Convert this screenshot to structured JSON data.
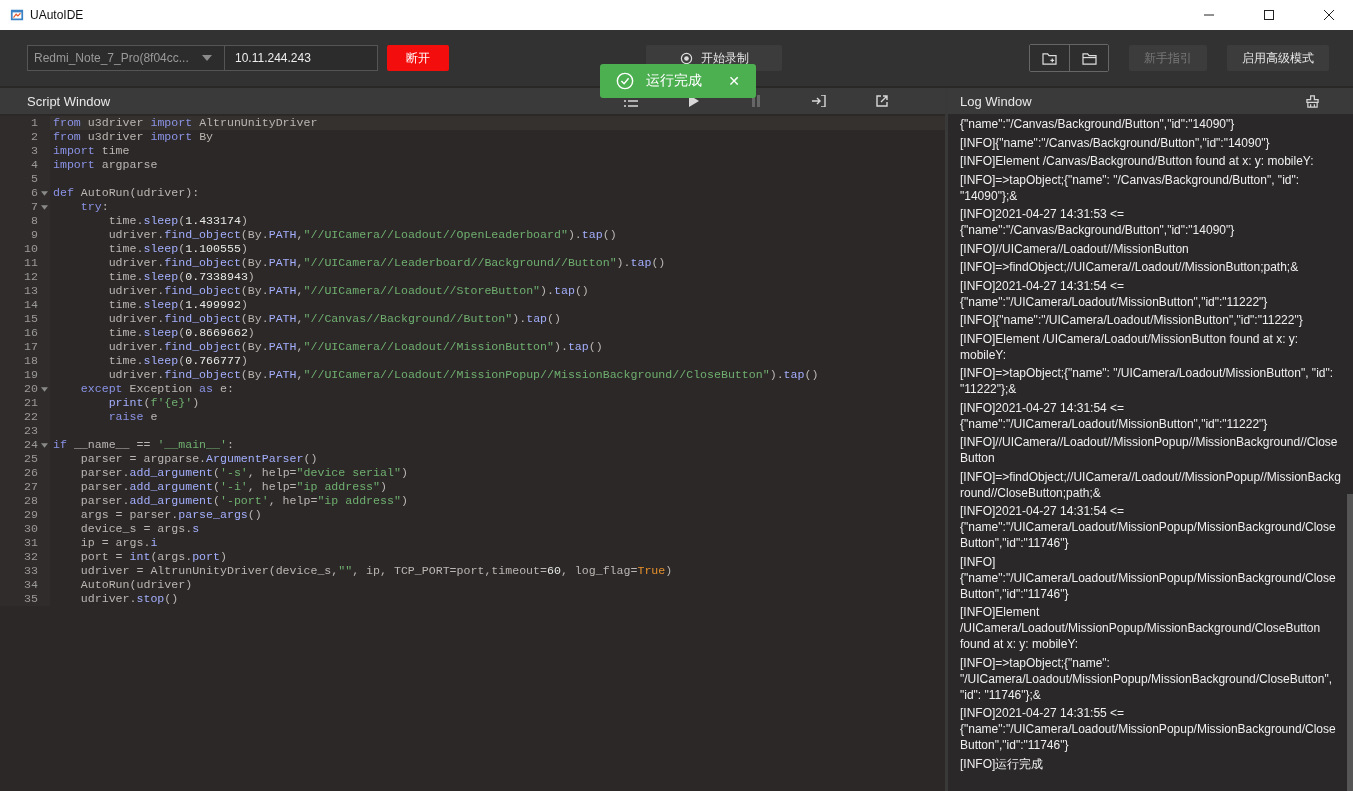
{
  "window": {
    "title": "UAutoIDE"
  },
  "toolbar": {
    "device": "Redmi_Note_7_Pro(8f04cc...",
    "ip": "10.11.244.243",
    "buttons": [
      {
        "kind": "disconnect",
        "label": "断开",
        "disabled": false
      },
      {
        "kind": "record",
        "label": "开始录制",
        "disabled": false
      },
      {
        "kind": "new-folder",
        "disabled": false
      },
      {
        "kind": "open-folder",
        "disabled": false
      },
      {
        "kind": "guide",
        "label": "新手指引",
        "disabled": true
      },
      {
        "kind": "advanced",
        "label": "启用高级模式",
        "disabled": false
      }
    ]
  },
  "toast": {
    "message": "运行完成",
    "close": "✕"
  },
  "script_window": {
    "title": "Script Window",
    "tools": [
      {
        "kind": "list",
        "disabled": false
      },
      {
        "kind": "play",
        "disabled": false
      },
      {
        "kind": "pause",
        "disabled": true
      },
      {
        "kind": "export",
        "disabled": false
      },
      {
        "kind": "external",
        "disabled": false
      }
    ],
    "lines": [
      {
        "n": "1",
        "fold": false,
        "tokens": [
          {
            "kind": "kw",
            "text": "from"
          },
          {
            "kind": "plain",
            "text": " u3driver "
          },
          {
            "kind": "kw",
            "text": "import"
          },
          {
            "kind": "plain",
            "text": " AltrunUnityDriver"
          }
        ]
      },
      {
        "n": "2",
        "fold": false,
        "tokens": [
          {
            "kind": "kw",
            "text": "from"
          },
          {
            "kind": "plain",
            "text": " u3driver "
          },
          {
            "kind": "kw",
            "text": "import"
          },
          {
            "kind": "plain",
            "text": " By"
          }
        ]
      },
      {
        "n": "3",
        "fold": false,
        "tokens": [
          {
            "kind": "kw",
            "text": "import"
          },
          {
            "kind": "plain",
            "text": " time"
          }
        ]
      },
      {
        "n": "4",
        "fold": false,
        "tokens": [
          {
            "kind": "kw",
            "text": "import"
          },
          {
            "kind": "plain",
            "text": " argparse"
          }
        ]
      },
      {
        "n": "5",
        "fold": false
      },
      {
        "n": "6",
        "fold": true,
        "tokens": [
          {
            "kind": "kw",
            "text": "def"
          },
          {
            "kind": "plain",
            "text": " AutoRun(udriver):"
          }
        ]
      },
      {
        "n": "7",
        "fold": true,
        "tokens": [
          {
            "kind": "kw",
            "text": "    try"
          },
          {
            "kind": "plain",
            "text": ":"
          }
        ]
      },
      {
        "n": "8",
        "fold": false,
        "tokens": [
          {
            "kind": "plain",
            "text": "        time."
          },
          {
            "kind": "fn",
            "text": "sleep"
          },
          {
            "kind": "plain",
            "text": "("
          },
          {
            "kind": "num",
            "text": "1.433174"
          },
          {
            "kind": "plain",
            "text": ")"
          }
        ]
      },
      {
        "n": "9",
        "fold": false,
        "tokens": [
          {
            "kind": "plain",
            "text": "        udriver."
          },
          {
            "kind": "fn",
            "text": "find_object"
          },
          {
            "kind": "plain",
            "text": "(By."
          },
          {
            "kind": "fn",
            "text": "PATH"
          },
          {
            "kind": "plain",
            "text": ","
          },
          {
            "kind": "str",
            "text": "\"//UICamera//Loadout//OpenLeaderboard\""
          },
          {
            "kind": "plain",
            "text": ")."
          },
          {
            "kind": "fn",
            "text": "tap"
          },
          {
            "kind": "plain",
            "text": "()"
          }
        ]
      },
      {
        "n": "10",
        "fold": false,
        "tokens": [
          {
            "kind": "plain",
            "text": "        time."
          },
          {
            "kind": "fn",
            "text": "sleep"
          },
          {
            "kind": "plain",
            "text": "("
          },
          {
            "kind": "num",
            "text": "1.100555"
          },
          {
            "kind": "plain",
            "text": ")"
          }
        ]
      },
      {
        "n": "11",
        "fold": false,
        "tokens": [
          {
            "kind": "plain",
            "text": "        udriver."
          },
          {
            "kind": "fn",
            "text": "find_object"
          },
          {
            "kind": "plain",
            "text": "(By."
          },
          {
            "kind": "fn",
            "text": "PATH"
          },
          {
            "kind": "plain",
            "text": ","
          },
          {
            "kind": "str",
            "text": "\"//UICamera//Leaderboard//Background//Button\""
          },
          {
            "kind": "plain",
            "text": ")."
          },
          {
            "kind": "fn",
            "text": "tap"
          },
          {
            "kind": "plain",
            "text": "()"
          }
        ]
      },
      {
        "n": "12",
        "fold": false,
        "tokens": [
          {
            "kind": "plain",
            "text": "        time."
          },
          {
            "kind": "fn",
            "text": "sleep"
          },
          {
            "kind": "plain",
            "text": "("
          },
          {
            "kind": "num",
            "text": "0.7338943"
          },
          {
            "kind": "plain",
            "text": ")"
          }
        ]
      },
      {
        "n": "13",
        "fold": false,
        "tokens": [
          {
            "kind": "plain",
            "text": "        udriver."
          },
          {
            "kind": "fn",
            "text": "find_object"
          },
          {
            "kind": "plain",
            "text": "(By."
          },
          {
            "kind": "fn",
            "text": "PATH"
          },
          {
            "kind": "plain",
            "text": ","
          },
          {
            "kind": "str",
            "text": "\"//UICamera//Loadout//StoreButton\""
          },
          {
            "kind": "plain",
            "text": ")."
          },
          {
            "kind": "fn",
            "text": "tap"
          },
          {
            "kind": "plain",
            "text": "()"
          }
        ]
      },
      {
        "n": "14",
        "fold": false,
        "tokens": [
          {
            "kind": "plain",
            "text": "        time."
          },
          {
            "kind": "fn",
            "text": "sleep"
          },
          {
            "kind": "plain",
            "text": "("
          },
          {
            "kind": "num",
            "text": "1.499992"
          },
          {
            "kind": "plain",
            "text": ")"
          }
        ]
      },
      {
        "n": "15",
        "fold": false,
        "tokens": [
          {
            "kind": "plain",
            "text": "        udriver."
          },
          {
            "kind": "fn",
            "text": "find_object"
          },
          {
            "kind": "plain",
            "text": "(By."
          },
          {
            "kind": "fn",
            "text": "PATH"
          },
          {
            "kind": "plain",
            "text": ","
          },
          {
            "kind": "str",
            "text": "\"//Canvas//Background//Button\""
          },
          {
            "kind": "plain",
            "text": ")."
          },
          {
            "kind": "fn",
            "text": "tap"
          },
          {
            "kind": "plain",
            "text": "()"
          }
        ]
      },
      {
        "n": "16",
        "fold": false,
        "tokens": [
          {
            "kind": "plain",
            "text": "        time."
          },
          {
            "kind": "fn",
            "text": "sleep"
          },
          {
            "kind": "plain",
            "text": "("
          },
          {
            "kind": "num",
            "text": "0.8669662"
          },
          {
            "kind": "plain",
            "text": ")"
          }
        ]
      },
      {
        "n": "17",
        "fold": false,
        "tokens": [
          {
            "kind": "plain",
            "text": "        udriver."
          },
          {
            "kind": "fn",
            "text": "find_object"
          },
          {
            "kind": "plain",
            "text": "(By."
          },
          {
            "kind": "fn",
            "text": "PATH"
          },
          {
            "kind": "plain",
            "text": ","
          },
          {
            "kind": "str",
            "text": "\"//UICamera//Loadout//MissionButton\""
          },
          {
            "kind": "plain",
            "text": ")."
          },
          {
            "kind": "fn",
            "text": "tap"
          },
          {
            "kind": "plain",
            "text": "()"
          }
        ]
      },
      {
        "n": "18",
        "fold": false,
        "tokens": [
          {
            "kind": "plain",
            "text": "        time."
          },
          {
            "kind": "fn",
            "text": "sleep"
          },
          {
            "kind": "plain",
            "text": "("
          },
          {
            "kind": "num",
            "text": "0.766777"
          },
          {
            "kind": "plain",
            "text": ")"
          }
        ]
      },
      {
        "n": "19",
        "fold": false,
        "tokens": [
          {
            "kind": "plain",
            "text": "        udriver."
          },
          {
            "kind": "fn",
            "text": "find_object"
          },
          {
            "kind": "plain",
            "text": "(By."
          },
          {
            "kind": "fn",
            "text": "PATH"
          },
          {
            "kind": "plain",
            "text": ","
          },
          {
            "kind": "str",
            "text": "\"//UICamera//Loadout//MissionPopup//MissionBackground//CloseButton\""
          },
          {
            "kind": "plain",
            "text": ")."
          },
          {
            "kind": "fn",
            "text": "tap"
          },
          {
            "kind": "plain",
            "text": "()"
          }
        ]
      },
      {
        "n": "20",
        "fold": true,
        "tokens": [
          {
            "kind": "kw",
            "text": "    except"
          },
          {
            "kind": "plain",
            "text": " Exception "
          },
          {
            "kind": "kw",
            "text": "as"
          },
          {
            "kind": "plain",
            "text": " e:"
          }
        ]
      },
      {
        "n": "21",
        "fold": false,
        "tokens": [
          {
            "kind": "fn",
            "text": "        print"
          },
          {
            "kind": "plain",
            "text": "("
          },
          {
            "kind": "str",
            "text": "f'{e}'"
          },
          {
            "kind": "plain",
            "text": ")"
          }
        ]
      },
      {
        "n": "22",
        "fold": false,
        "tokens": [
          {
            "kind": "kw",
            "text": "        raise"
          },
          {
            "kind": "plain",
            "text": " e"
          }
        ]
      },
      {
        "n": "23",
        "fold": false
      },
      {
        "n": "24",
        "fold": true,
        "tokens": [
          {
            "kind": "kw",
            "text": "if"
          },
          {
            "kind": "plain",
            "text": " __name__ == "
          },
          {
            "kind": "str",
            "text": "'__main__'"
          },
          {
            "kind": "plain",
            "text": ":"
          }
        ]
      },
      {
        "n": "25",
        "fold": false,
        "tokens": [
          {
            "kind": "plain",
            "text": "    parser = argparse."
          },
          {
            "kind": "fn",
            "text": "ArgumentParser"
          },
          {
            "kind": "plain",
            "text": "()"
          }
        ]
      },
      {
        "n": "26",
        "fold": false,
        "tokens": [
          {
            "kind": "plain",
            "text": "    parser."
          },
          {
            "kind": "fn",
            "text": "add_argument"
          },
          {
            "kind": "plain",
            "text": "("
          },
          {
            "kind": "str",
            "text": "'-s'"
          },
          {
            "kind": "plain",
            "text": ", help="
          },
          {
            "kind": "str",
            "text": "\"device serial\""
          },
          {
            "kind": "plain",
            "text": ")"
          }
        ]
      },
      {
        "n": "27",
        "fold": false,
        "tokens": [
          {
            "kind": "plain",
            "text": "    parser."
          },
          {
            "kind": "fn",
            "text": "add_argument"
          },
          {
            "kind": "plain",
            "text": "("
          },
          {
            "kind": "str",
            "text": "'-i'"
          },
          {
            "kind": "plain",
            "text": ", help="
          },
          {
            "kind": "str",
            "text": "\"ip address\""
          },
          {
            "kind": "plain",
            "text": ")"
          }
        ]
      },
      {
        "n": "28",
        "fold": false,
        "tokens": [
          {
            "kind": "plain",
            "text": "    parser."
          },
          {
            "kind": "fn",
            "text": "add_argument"
          },
          {
            "kind": "plain",
            "text": "("
          },
          {
            "kind": "str",
            "text": "'-port'"
          },
          {
            "kind": "plain",
            "text": ", help="
          },
          {
            "kind": "str",
            "text": "\"ip address\""
          },
          {
            "kind": "plain",
            "text": ")"
          }
        ]
      },
      {
        "n": "29",
        "fold": false,
        "tokens": [
          {
            "kind": "plain",
            "text": "    args = parser."
          },
          {
            "kind": "fn",
            "text": "parse_args"
          },
          {
            "kind": "plain",
            "text": "()"
          }
        ]
      },
      {
        "n": "30",
        "fold": false,
        "tokens": [
          {
            "kind": "plain",
            "text": "    device_s = args."
          },
          {
            "kind": "fn",
            "text": "s"
          }
        ]
      },
      {
        "n": "31",
        "fold": false,
        "tokens": [
          {
            "kind": "plain",
            "text": "    ip = args."
          },
          {
            "kind": "fn",
            "text": "i"
          }
        ]
      },
      {
        "n": "32",
        "fold": false,
        "tokens": [
          {
            "kind": "plain",
            "text": "    port = "
          },
          {
            "kind": "fn",
            "text": "int"
          },
          {
            "kind": "plain",
            "text": "(args."
          },
          {
            "kind": "fn",
            "text": "port"
          },
          {
            "kind": "plain",
            "text": ")"
          }
        ]
      },
      {
        "n": "33",
        "fold": false,
        "tokens": [
          {
            "kind": "plain",
            "text": "    udriver = AltrunUnityDriver(device_s,"
          },
          {
            "kind": "str",
            "text": "\"\""
          },
          {
            "kind": "plain",
            "text": ", ip, TCP_PORT=port,timeout="
          },
          {
            "kind": "num",
            "text": "60"
          },
          {
            "kind": "plain",
            "text": ", log_flag="
          },
          {
            "kind": "const",
            "text": "True"
          },
          {
            "kind": "plain",
            "text": ")"
          }
        ]
      },
      {
        "n": "34",
        "fold": false,
        "tokens": [
          {
            "kind": "plain",
            "text": "    AutoRun(udriver)"
          }
        ]
      },
      {
        "n": "35",
        "fold": false,
        "tokens": [
          {
            "kind": "plain",
            "text": "    udriver."
          },
          {
            "kind": "fn",
            "text": "stop"
          },
          {
            "kind": "plain",
            "text": "()"
          }
        ]
      }
    ]
  },
  "log_window": {
    "title": "Log Window",
    "entries": [
      "{\"name\":\"/Canvas/Background/Button\",\"id\":\"14090\"}",
      "[INFO]{\"name\":\"/Canvas/Background/Button\",\"id\":\"14090\"}",
      "[INFO]Element /Canvas/Background/Button found at x: y: mobileY:",
      "[INFO]=>tapObject;{\"name\": \"/Canvas/Background/Button\", \"id\": \"14090\"};&",
      "[INFO]2021-04-27 14:31:53 <= {\"name\":\"/Canvas/Background/Button\",\"id\":\"14090\"}",
      "[INFO]//UICamera//Loadout//MissionButton",
      "[INFO]=>findObject;//UICamera//Loadout//MissionButton;path;&",
      "[INFO]2021-04-27 14:31:54 <= {\"name\":\"/UICamera/Loadout/MissionButton\",\"id\":\"11222\"}",
      "[INFO]{\"name\":\"/UICamera/Loadout/MissionButton\",\"id\":\"11222\"}",
      "[INFO]Element /UICamera/Loadout/MissionButton found at x: y: mobileY:",
      "[INFO]=>tapObject;{\"name\": \"/UICamera/Loadout/MissionButton\", \"id\": \"11222\"};&",
      "[INFO]2021-04-27 14:31:54 <= {\"name\":\"/UICamera/Loadout/MissionButton\",\"id\":\"11222\"}",
      "[INFO]//UICamera//Loadout//MissionPopup//MissionBackground//CloseButton",
      "[INFO]=>findObject;//UICamera//Loadout//MissionPopup//MissionBackground//CloseButton;path;&",
      "[INFO]2021-04-27 14:31:54 <= {\"name\":\"/UICamera/Loadout/MissionPopup/MissionBackground/CloseButton\",\"id\":\"11746\"}",
      "[INFO] {\"name\":\"/UICamera/Loadout/MissionPopup/MissionBackground/CloseButton\",\"id\":\"11746\"}",
      "[INFO]Element /UICamera/Loadout/MissionPopup/MissionBackground/CloseButton found at x: y: mobileY:",
      "[INFO]=>tapObject;{\"name\": \"/UICamera/Loadout/MissionPopup/MissionBackground/CloseButton\", \"id\": \"11746\"};&",
      "[INFO]2021-04-27 14:31:55 <= {\"name\":\"/UICamera/Loadout/MissionPopup/MissionBackground/CloseButton\",\"id\":\"11746\"}",
      "[INFO]运行完成"
    ]
  }
}
